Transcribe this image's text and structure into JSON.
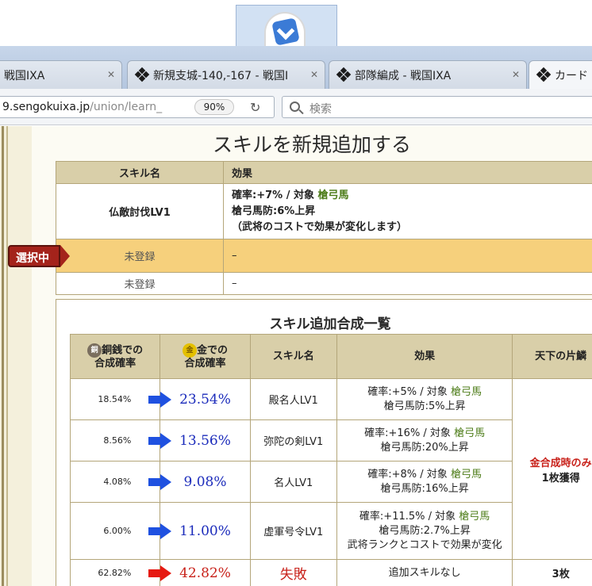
{
  "browser": {
    "tabs": [
      {
        "label": "戦国IXA"
      },
      {
        "label": "新規支城-140,-167 - 戦国I"
      },
      {
        "label": "部隊編成 - 戦国IXA"
      },
      {
        "label": "カード"
      }
    ],
    "url_host": "9.sengokuixa.jp",
    "url_path": "/union/learn_",
    "zoom": "90%",
    "search_placeholder": "検索"
  },
  "page": {
    "heading": "スキルを新規追加する",
    "selected_badge": "選択中",
    "skill_table": {
      "headers": {
        "name": "スキル名",
        "effect": "効果"
      },
      "rows": [
        {
          "name": "仏敵討伐LV1",
          "effect_line1_prefix": "確率:+7%  /  対象 ",
          "effect_line1_target": "槍弓馬",
          "effect_line2": "槍弓馬防:6%上昇",
          "effect_line3": "（武将のコストで効果が変化します）"
        },
        {
          "name": "未登録",
          "effect": "–"
        },
        {
          "name": "未登録",
          "effect": "–"
        }
      ]
    },
    "combo_list": {
      "title": "スキル追加合成一覧",
      "headers": {
        "copper": "銅銭での\n合成確率",
        "copper_coin": "銅",
        "gold": "金での\n合成確率",
        "gold_coin": "金",
        "skill": "スキル名",
        "effect": "効果",
        "scale": "天下の片鱗"
      },
      "rows": [
        {
          "copper": "18.54%",
          "gold": "23.54%",
          "skill": "殿名人LV1",
          "effect_prefix": "確率:+5%  /  対象 ",
          "effect_target": "槍弓馬",
          "effect_line2": "槍弓馬防:5%上昇",
          "effect_line3": ""
        },
        {
          "copper": "8.56%",
          "gold": "13.56%",
          "skill": "弥陀の剣LV1",
          "effect_prefix": "確率:+16%  /  対象 ",
          "effect_target": "槍弓馬",
          "effect_line2": "槍弓馬防:20%上昇",
          "effect_line3": ""
        },
        {
          "copper": "4.08%",
          "gold": "9.08%",
          "skill": "名人LV1",
          "effect_prefix": "確率:+8%  /  対象 ",
          "effect_target": "槍弓馬",
          "effect_line2": "槍弓馬防:16%上昇",
          "effect_line3": ""
        },
        {
          "copper": "6.00%",
          "gold": "11.00%",
          "skill": "虚軍号令LV1",
          "effect_prefix": "確率:+11.5%  /  対象 ",
          "effect_target": "槍弓馬",
          "effect_line2": "槍弓馬防:2.7%上昇",
          "effect_line3": "武将ランクとコストで効果が変化"
        },
        {
          "copper": "62.82%",
          "gold": "42.82%",
          "skill": "失敗",
          "effect": "追加スキルなし",
          "scale": "3枚"
        }
      ],
      "scale_note_line1": "金合成時のみ",
      "scale_note_line2": "1枚獲得"
    }
  },
  "colors": {
    "accent_blue": "#1b2bbb",
    "failure_red": "#c8211a",
    "target_green": "#4e7d1a",
    "selected_row": "#f6d07c"
  }
}
